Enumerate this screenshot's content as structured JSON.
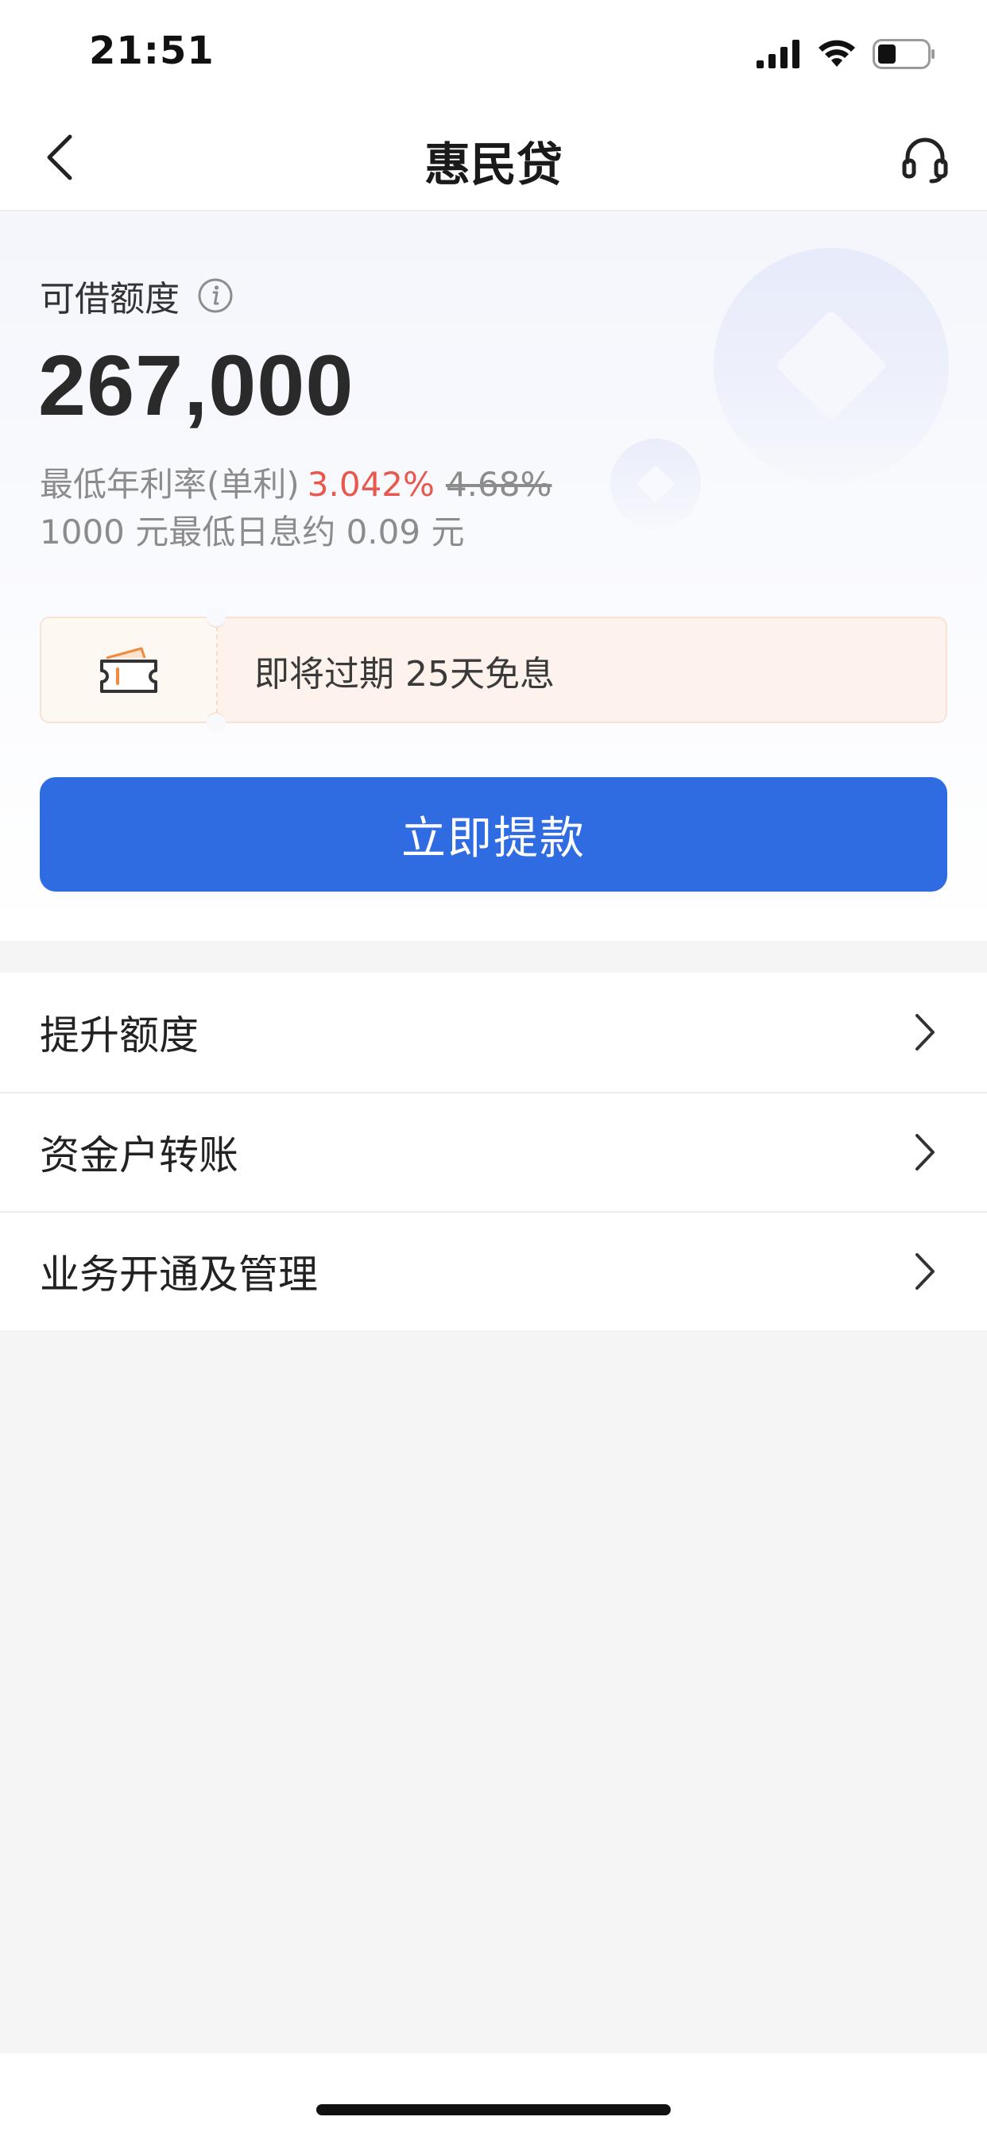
{
  "status_bar": {
    "time": "21:51"
  },
  "nav": {
    "title": "惠民贷"
  },
  "hero": {
    "credit_label": "可借额度",
    "credit_amount": "267,000",
    "rate_prefix": "最低年利率(单利)",
    "rate_current": "3.042%",
    "rate_old": "4.68%",
    "daily_interest": "1000 元最低日息约 0.09 元"
  },
  "coupon": {
    "text": "即将过期 25天免息"
  },
  "primary_action": {
    "label": "立即提款"
  },
  "menu": {
    "items": [
      {
        "label": "提升额度"
      },
      {
        "label": "资金户转账"
      },
      {
        "label": "业务开通及管理"
      }
    ]
  },
  "colors": {
    "primary": "#2f6ce2",
    "rate_highlight": "#e8584d",
    "coupon_bg": "#fdf3ec",
    "coupon_accent": "#f08a3c"
  },
  "icons": {
    "back": "chevron-left-icon",
    "service": "headset-icon",
    "info": "info-icon",
    "coupon": "ticket-icon",
    "menu_arrow": "chevron-right-icon"
  }
}
